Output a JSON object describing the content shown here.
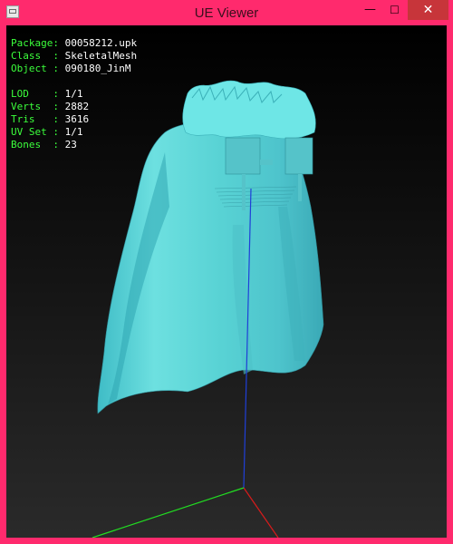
{
  "window": {
    "title": "UE Viewer",
    "controls": {
      "minimize": "—",
      "maximize": "☐",
      "close": "✕"
    },
    "colors": {
      "frame": "#ff2a6d",
      "close_bg": "#c7353a"
    }
  },
  "info": {
    "package": {
      "label": "Package:",
      "value": "00058212.upk"
    },
    "class": {
      "label": "Class  :",
      "value": "SkeletalMesh"
    },
    "object": {
      "label": "Object :",
      "value": "090180_JinM"
    },
    "lod": {
      "label": "LOD    :",
      "value": "1/1"
    },
    "verts": {
      "label": "Verts  :",
      "value": "2882"
    },
    "tris": {
      "label": "Tris   :",
      "value": "3616"
    },
    "uvset": {
      "label": "UV Set :",
      "value": "1/1"
    },
    "bones": {
      "label": "Bones  :",
      "value": "23"
    }
  },
  "viewport": {
    "mesh_color": "#5ad8d8",
    "axes": {
      "x": "#d81b1b",
      "y": "#22dd22",
      "z": "#1f3fd8"
    }
  }
}
